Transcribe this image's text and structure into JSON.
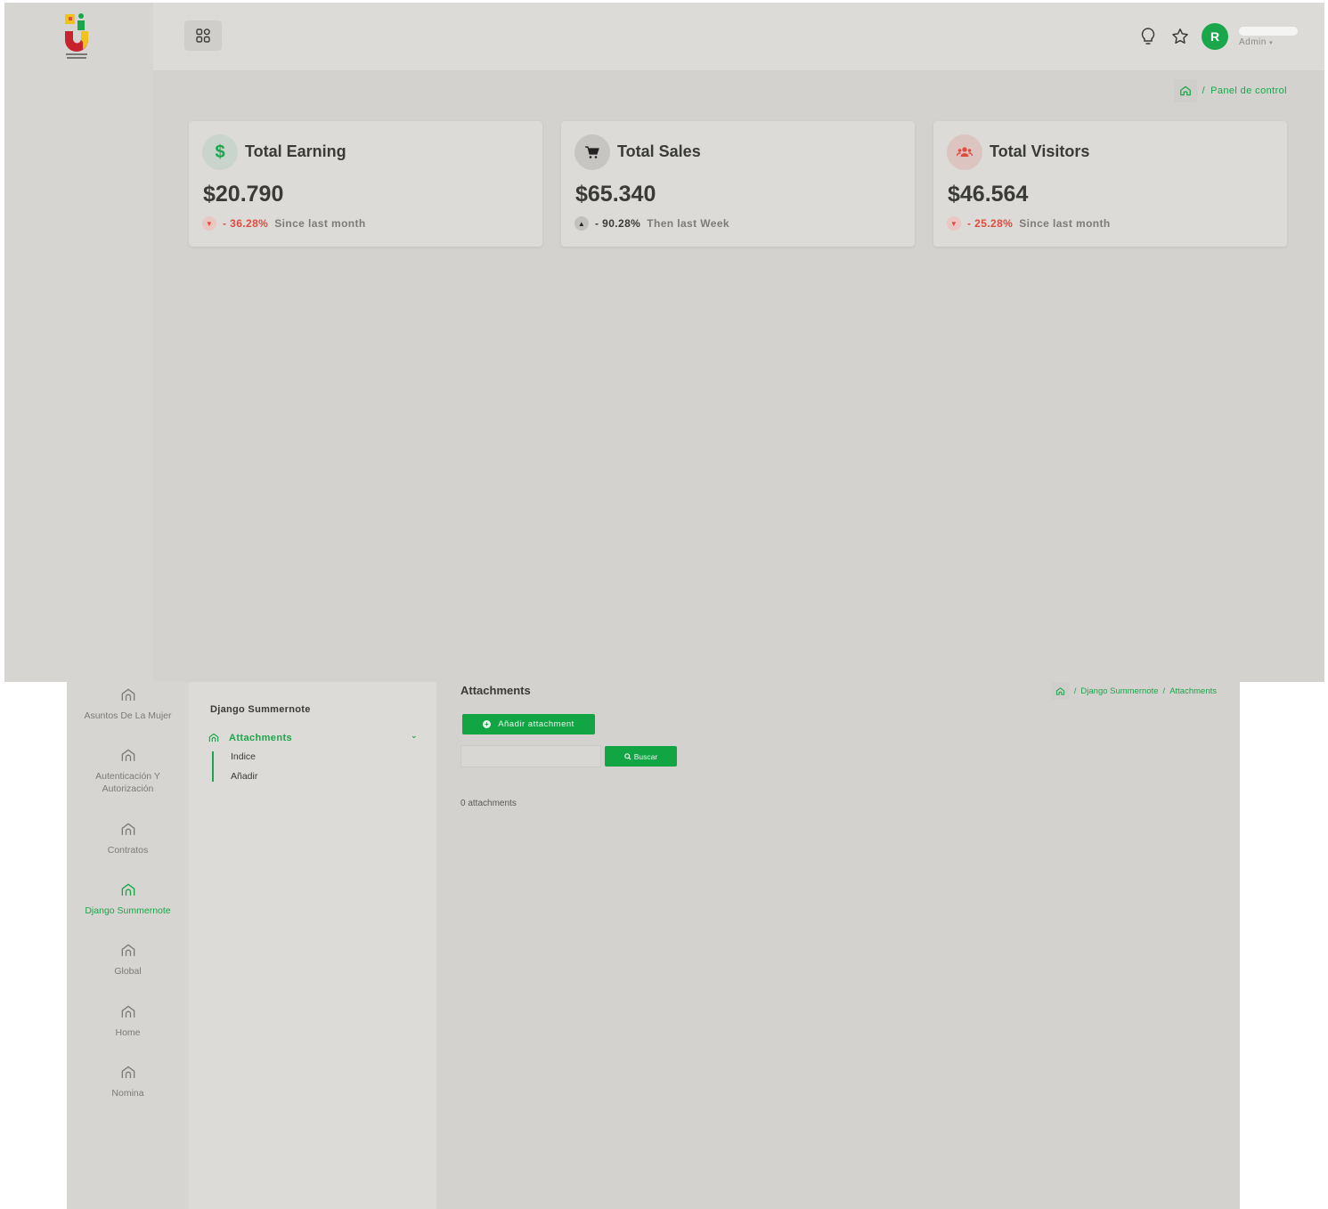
{
  "dashboard": {
    "header": {
      "menu_icon": "grid-icon",
      "icons": [
        "lightbulb-icon",
        "star-icon"
      ],
      "avatar_initial": "R",
      "user_role": "Admin"
    },
    "breadcrumb": {
      "home_icon": "home-icon",
      "separator": "/",
      "current": "Panel de control"
    },
    "cards": [
      {
        "title": "Total Earning",
        "amount": "$20.790",
        "icon": "dollar-icon",
        "icon_glyph": "$",
        "icon_bg": "#c8d4cc",
        "icon_color": "#1aa64a",
        "trend_direction": "down",
        "trend_value": "- 36.28%",
        "trend_color": "#e04b3f",
        "trend_text": "Since last month"
      },
      {
        "title": "Total Sales",
        "amount": "$65.340",
        "icon": "cart-icon",
        "icon_bg": "#c6c5c1",
        "icon_color": "#222222",
        "trend_direction": "up",
        "trend_value": "- 90.28%",
        "trend_color": "#3a3a38",
        "trend_text": "Then last Week"
      },
      {
        "title": "Total Visitors",
        "amount": "$46.564",
        "icon": "users-icon",
        "icon_bg": "#dcc5c0",
        "icon_color": "#e04b3f",
        "trend_direction": "down",
        "trend_value": "- 25.28%",
        "trend_color": "#e04b3f",
        "trend_text": "Since last month"
      }
    ]
  },
  "attachments_page": {
    "rail": [
      {
        "label": "Asuntos De La Mujer",
        "active": false
      },
      {
        "label": "Autenticación Y Autorización",
        "active": false
      },
      {
        "label": "Contratos",
        "active": false
      },
      {
        "label": "Django Summernote",
        "active": true
      },
      {
        "label": "Global",
        "active": false
      },
      {
        "label": "Home",
        "active": false
      },
      {
        "label": "Nomina",
        "active": false
      }
    ],
    "sidebar": {
      "app_name": "Django Summernote",
      "model": "Attachments",
      "links": [
        "Indice",
        "Añadir"
      ]
    },
    "title": "Attachments",
    "breadcrumb": [
      "Django Summernote",
      "Attachments"
    ],
    "add_button": "Añadir attachment",
    "search_value": "",
    "search_button": "Buscar",
    "count_text": "0 attachments"
  },
  "colors": {
    "accent": "#1aa64a",
    "danger": "#e04b3f"
  }
}
